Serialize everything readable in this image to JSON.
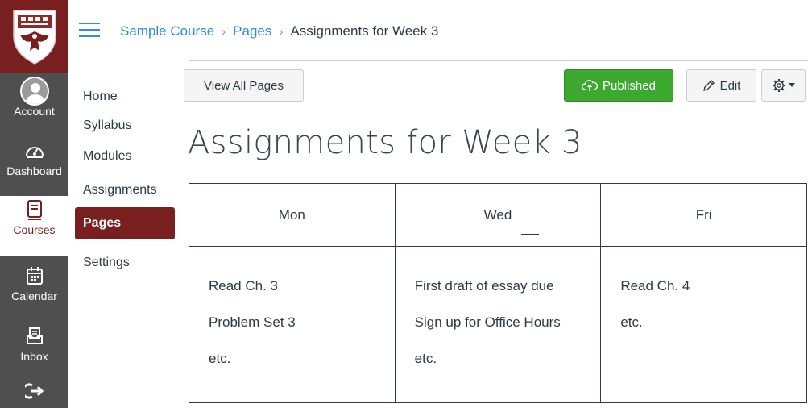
{
  "global_nav": {
    "items": [
      {
        "label": "Account",
        "icon": "avatar-icon"
      },
      {
        "label": "Dashboard",
        "icon": "dashboard-icon"
      },
      {
        "label": "Courses",
        "icon": "courses-icon",
        "active": true
      },
      {
        "label": "Calendar",
        "icon": "calendar-icon"
      },
      {
        "label": "Inbox",
        "icon": "inbox-icon"
      },
      {
        "label": "",
        "icon": "logout-icon"
      }
    ],
    "colors": {
      "background": "#4f4f4f",
      "brand": "#7a1f1f",
      "active_text": "#7a1f1f"
    }
  },
  "breadcrumb": {
    "course": "Sample Course",
    "section": "Pages",
    "current": "Assignments for Week 3",
    "separator": "›"
  },
  "course_nav": {
    "items": [
      {
        "label": "Home"
      },
      {
        "label": "Syllabus"
      },
      {
        "label": "Modules"
      },
      {
        "label": "Assignments"
      },
      {
        "label": "Pages",
        "active": true
      },
      {
        "label": "Settings"
      }
    ]
  },
  "toolbar": {
    "view_all_label": "View All Pages",
    "published_label": "Published",
    "edit_label": "Edit",
    "colors": {
      "published": "#3ca82f",
      "link": "#2d8be0"
    }
  },
  "page": {
    "title": "Assignments for Week 3",
    "table": {
      "headers": [
        "Mon",
        "Wed",
        "Fri"
      ],
      "cells": [
        [
          "Read Ch. 3",
          "Problem Set 3",
          "etc."
        ],
        [
          "First draft of essay due",
          "Sign up for Office Hours",
          "etc."
        ],
        [
          "Read Ch. 4",
          "etc."
        ]
      ]
    }
  }
}
